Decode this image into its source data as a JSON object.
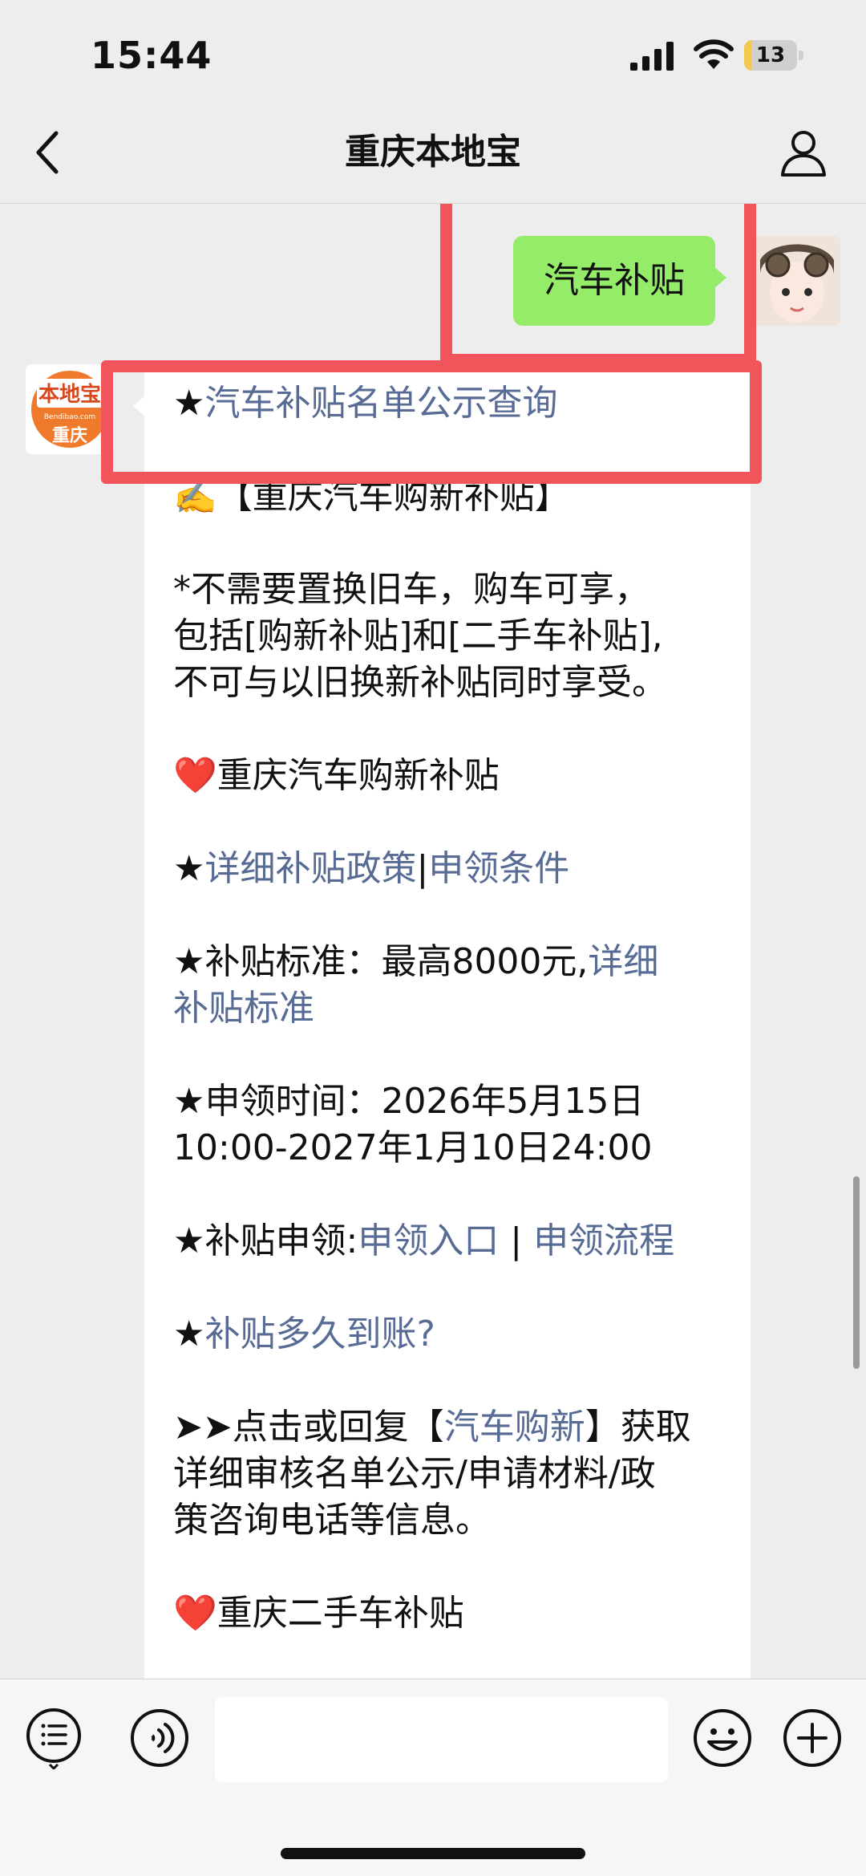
{
  "status_bar": {
    "time": "15:44",
    "battery_level": "13"
  },
  "nav": {
    "title": "重庆本地宝"
  },
  "messages": {
    "user_text": "汽车补贴",
    "bot_avatar_text_top": "本地宝",
    "bot_avatar_text_mid": "Bendibao.com",
    "bot_avatar_text_bottom": "重庆",
    "l1_star": "★",
    "l1_link": "汽车补贴名单公示查询",
    "l2": "✍️【重庆汽车购新补贴】",
    "l3a": "*不需要置换旧车，购车可享，",
    "l3b": "包括[购新补贴]和[二手车补贴],",
    "l3c": "不可与以旧换新补贴同时享受。",
    "l4": "❤️重庆汽车购新补贴",
    "l5_star": "★",
    "l5_link1": "详细补贴政策",
    "l5_sep": "|",
    "l5_link2": "申领条件",
    "l6_text": "★补贴标准：最高8000元,",
    "l6_link_a": "详细",
    "l6_link_b": "补贴标准",
    "l7a": "★申领时间：2026年5月15日",
    "l7b": "10:00-2027年1月10日24:00",
    "l8_text": "★补贴申领:",
    "l8_link1": "申领入口",
    "l8_sep": " | ",
    "l8_link2": "申领流程",
    "l9_star": "★",
    "l9_link": "补贴多久到账?",
    "l10_pre": "➤➤点击或回复【",
    "l10_link": "汽车购新",
    "l10_post": "】获取",
    "l10b": "详细审核名单公示/申请材料/政",
    "l10c": "策咨询电话等信息。",
    "l11": "❤️重庆二手车补贴"
  },
  "colors": {
    "link": "#576b95",
    "highlight": "#f2545b",
    "user_bubble": "#95ec69"
  },
  "icons": [
    "back-arrow-icon",
    "profile-icon",
    "menu-list-icon",
    "voice-icon",
    "emoji-icon",
    "plus-icon"
  ]
}
